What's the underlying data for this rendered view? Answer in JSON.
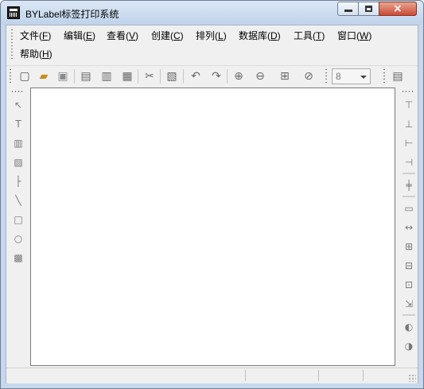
{
  "window": {
    "title": "BYLabel标签打印系统",
    "close_glyph": "×"
  },
  "menu": {
    "items": [
      {
        "label": "文件(",
        "key": "F",
        "tail": ")"
      },
      {
        "label": "编辑(",
        "key": "E",
        "tail": ")"
      },
      {
        "label": "查看(",
        "key": "V",
        "tail": ")"
      },
      {
        "label": "创建(",
        "key": "C",
        "tail": ")"
      },
      {
        "label": "排列(",
        "key": "L",
        "tail": ")"
      },
      {
        "label": "数据库(",
        "key": "D",
        "tail": ")"
      },
      {
        "label": "工具(",
        "key": "T",
        "tail": ")"
      },
      {
        "label": "窗口(",
        "key": "W",
        "tail": ")"
      },
      {
        "label": "帮助(",
        "key": "H",
        "tail": ")"
      }
    ]
  },
  "toolbar": {
    "icons": [
      {
        "name": "new-file-icon",
        "glyph": "▢"
      },
      {
        "name": "open-folder-icon",
        "glyph": "▰"
      },
      {
        "name": "save-icon",
        "glyph": "▣"
      },
      {
        "name": "print-icon",
        "glyph": "▤"
      },
      {
        "name": "print-setup-icon",
        "glyph": "▥"
      },
      {
        "name": "print-preview-icon",
        "glyph": "▦"
      },
      {
        "name": "cut-icon",
        "glyph": "✂"
      },
      {
        "name": "paste-icon",
        "glyph": "▧"
      },
      {
        "name": "undo-icon",
        "glyph": "↶"
      },
      {
        "name": "redo-icon",
        "glyph": "↷"
      },
      {
        "name": "zoom-in-icon",
        "glyph": "⊕"
      },
      {
        "name": "zoom-out-icon",
        "glyph": "⊖"
      },
      {
        "name": "fit-window-icon",
        "glyph": "⊞"
      },
      {
        "name": "no-zoom-icon",
        "glyph": "⊘"
      },
      {
        "name": "database-tool-icon",
        "glyph": "▤"
      }
    ],
    "zoom_value": "8"
  },
  "left_tools": [
    {
      "name": "pointer-tool-icon",
      "glyph": "↖"
    },
    {
      "name": "text-tool-icon",
      "glyph": "T"
    },
    {
      "name": "barcode-tool-icon",
      "glyph": "▥"
    },
    {
      "name": "image-tool-icon",
      "glyph": "▨"
    },
    {
      "name": "line-tool-icon",
      "glyph": "├"
    },
    {
      "name": "diagonal-line-tool-icon",
      "glyph": "╲"
    },
    {
      "name": "rectangle-tool-icon",
      "glyph": "□"
    },
    {
      "name": "ellipse-tool-icon",
      "glyph": "○"
    },
    {
      "name": "graphic-tool-icon",
      "glyph": "▩"
    }
  ],
  "right_tools": [
    {
      "name": "align-top-icon",
      "glyph": "⊤"
    },
    {
      "name": "align-bottom-icon",
      "glyph": "⊥"
    },
    {
      "name": "align-left-icon",
      "glyph": "⊢"
    },
    {
      "name": "align-right-icon",
      "glyph": "⊣"
    },
    {
      "name": "center-horizontal-icon",
      "glyph": "╪"
    },
    {
      "name": "center-vertical-icon",
      "glyph": "▭"
    },
    {
      "name": "distribute-horizontal-icon",
      "glyph": "↔"
    },
    {
      "name": "same-width-icon",
      "glyph": "⊞"
    },
    {
      "name": "same-height-icon",
      "glyph": "⊟"
    },
    {
      "name": "same-size-icon",
      "glyph": "⊡"
    },
    {
      "name": "distribute-vertical-icon",
      "glyph": "⇲"
    },
    {
      "name": "rotate-left-icon",
      "glyph": "◐"
    },
    {
      "name": "rotate-right-icon",
      "glyph": "◑"
    }
  ]
}
